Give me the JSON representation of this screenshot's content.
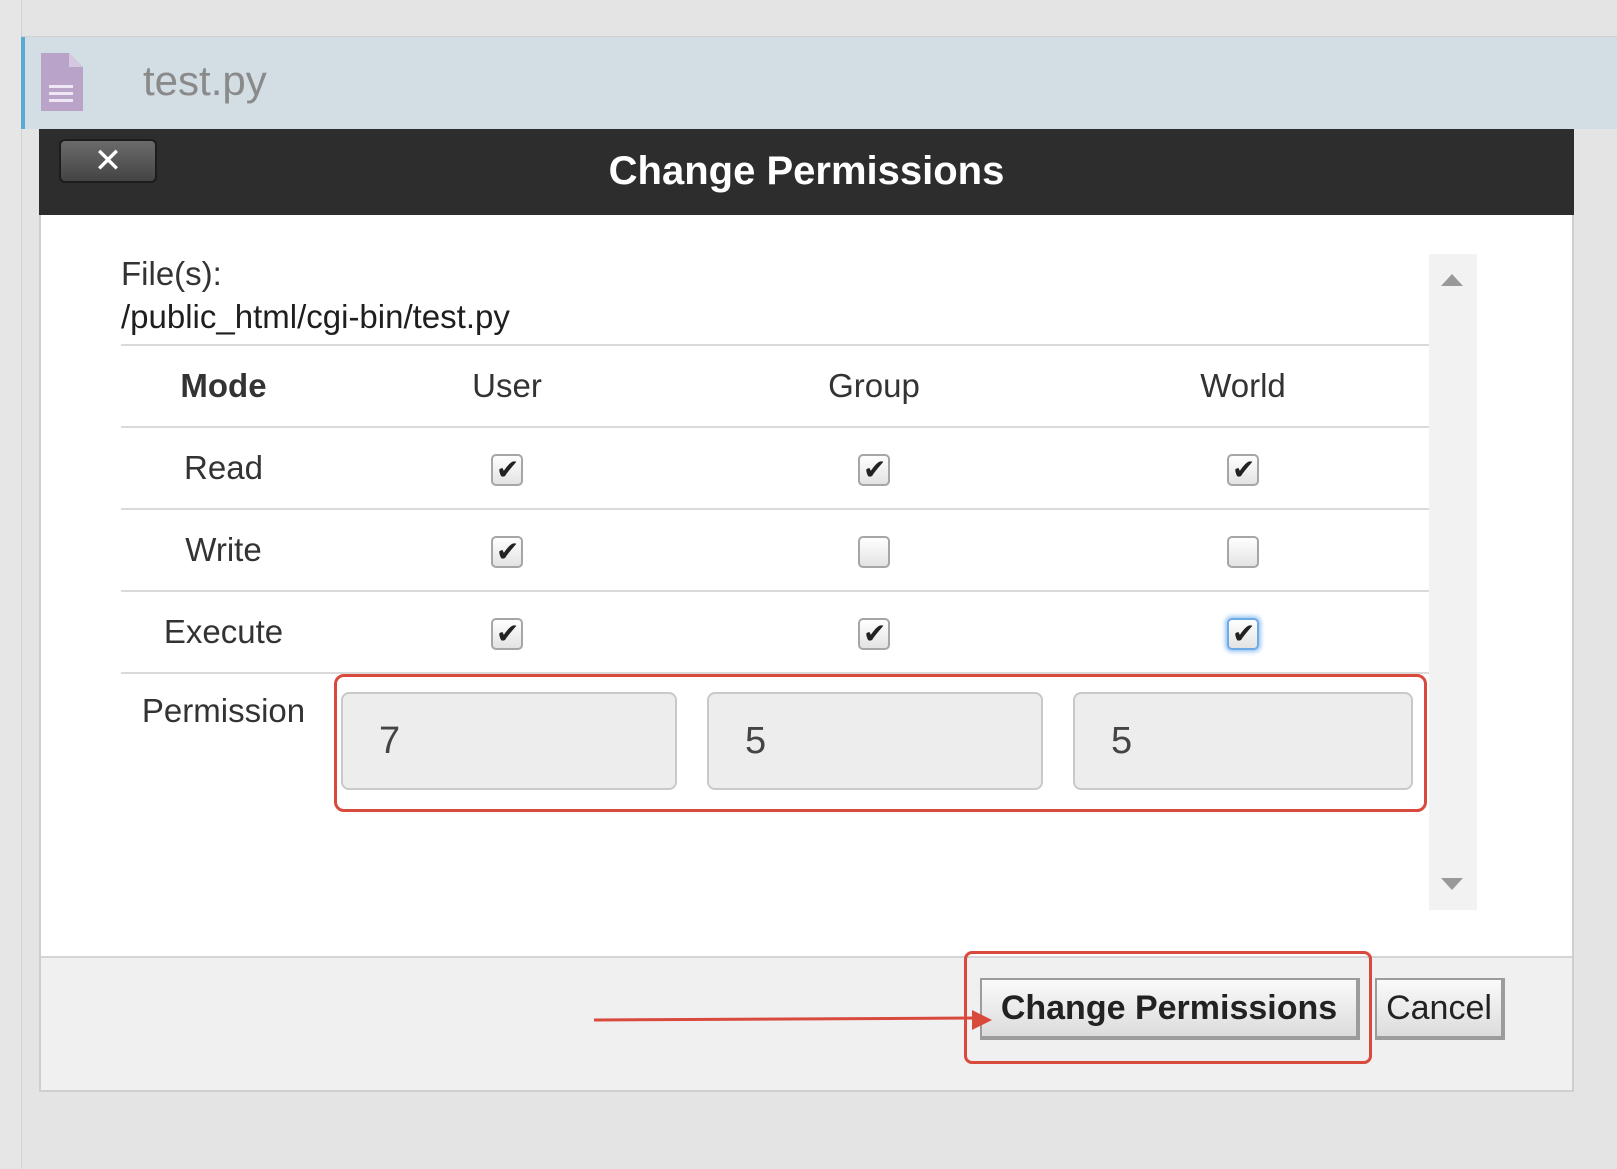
{
  "file_list": {
    "selected_file": "test.py",
    "icon": "document-icon"
  },
  "dialog": {
    "title": "Change Permissions",
    "close_label": "✕",
    "files_label": "File(s):",
    "file_path": "/public_html/cgi-bin/test.py",
    "table": {
      "headers": {
        "mode": "Mode",
        "user": "User",
        "group": "Group",
        "world": "World"
      },
      "rows": [
        {
          "label": "Read",
          "user": true,
          "group": true,
          "world": true
        },
        {
          "label": "Write",
          "user": true,
          "group": false,
          "world": false
        },
        {
          "label": "Execute",
          "user": true,
          "group": true,
          "world": true
        }
      ]
    },
    "permission": {
      "label": "Permission",
      "user": "7",
      "group": "5",
      "world": "5"
    },
    "buttons": {
      "change": "Change Permissions",
      "cancel": "Cancel"
    }
  },
  "colors": {
    "titlebar": "#2d2d2d",
    "highlight": "#d9493c",
    "selected_row": "#d3dde4"
  }
}
